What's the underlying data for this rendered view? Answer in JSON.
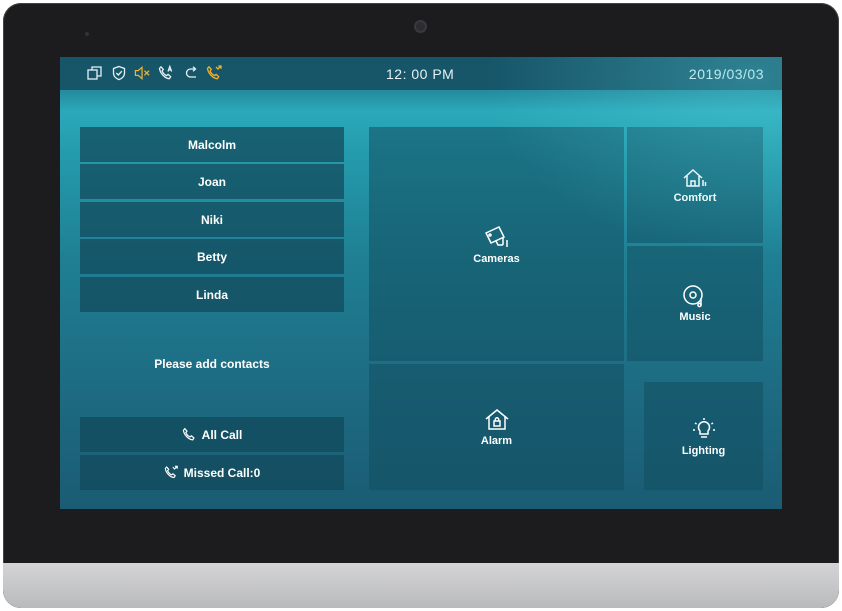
{
  "status": {
    "time": "12: 00 PM",
    "date": "2019/03/03",
    "icons": [
      "windows-icon",
      "shield-icon",
      "mute-icon",
      "auto-answer-icon",
      "forward-icon",
      "missed-call-icon"
    ],
    "accent_color": "#f2b233"
  },
  "contacts": [
    "Malcolm",
    "Joan",
    "Niki",
    "Betty",
    "Linda"
  ],
  "contacts_hint": "Please add contacts",
  "calls": {
    "all_label": "All Call",
    "missed_label": "Missed Call:0"
  },
  "tiles": {
    "cameras": "Cameras",
    "comfort": "Comfort",
    "music": "Music",
    "alarm": "Alarm",
    "lighting": "Lighting"
  }
}
